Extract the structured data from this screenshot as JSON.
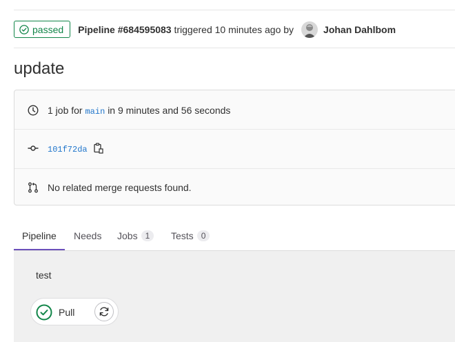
{
  "header": {
    "status": "passed",
    "pipeline_label": "Pipeline #684595083",
    "triggered_text": "triggered 10 minutes ago by",
    "author": "Johan Dahlbom"
  },
  "title": "update",
  "info": {
    "job_prefix": "1 job for",
    "branch": "main",
    "duration": "in 9 minutes and 56 seconds",
    "commit": "101f72da",
    "merge_requests": "No related merge requests found."
  },
  "tabs": [
    {
      "label": "Pipeline"
    },
    {
      "label": "Needs"
    },
    {
      "label": "Jobs",
      "count": "1"
    },
    {
      "label": "Tests",
      "count": "0"
    }
  ],
  "graph": {
    "stage": "test",
    "job_name": "Pull"
  },
  "colors": {
    "success": "#108548",
    "link": "#1f75cb",
    "active_tab": "#6b4fbb"
  },
  "icons": [
    "check-circle-icon",
    "clock-icon",
    "commit-icon",
    "copy-icon",
    "merge-request-icon",
    "retry-icon"
  ]
}
